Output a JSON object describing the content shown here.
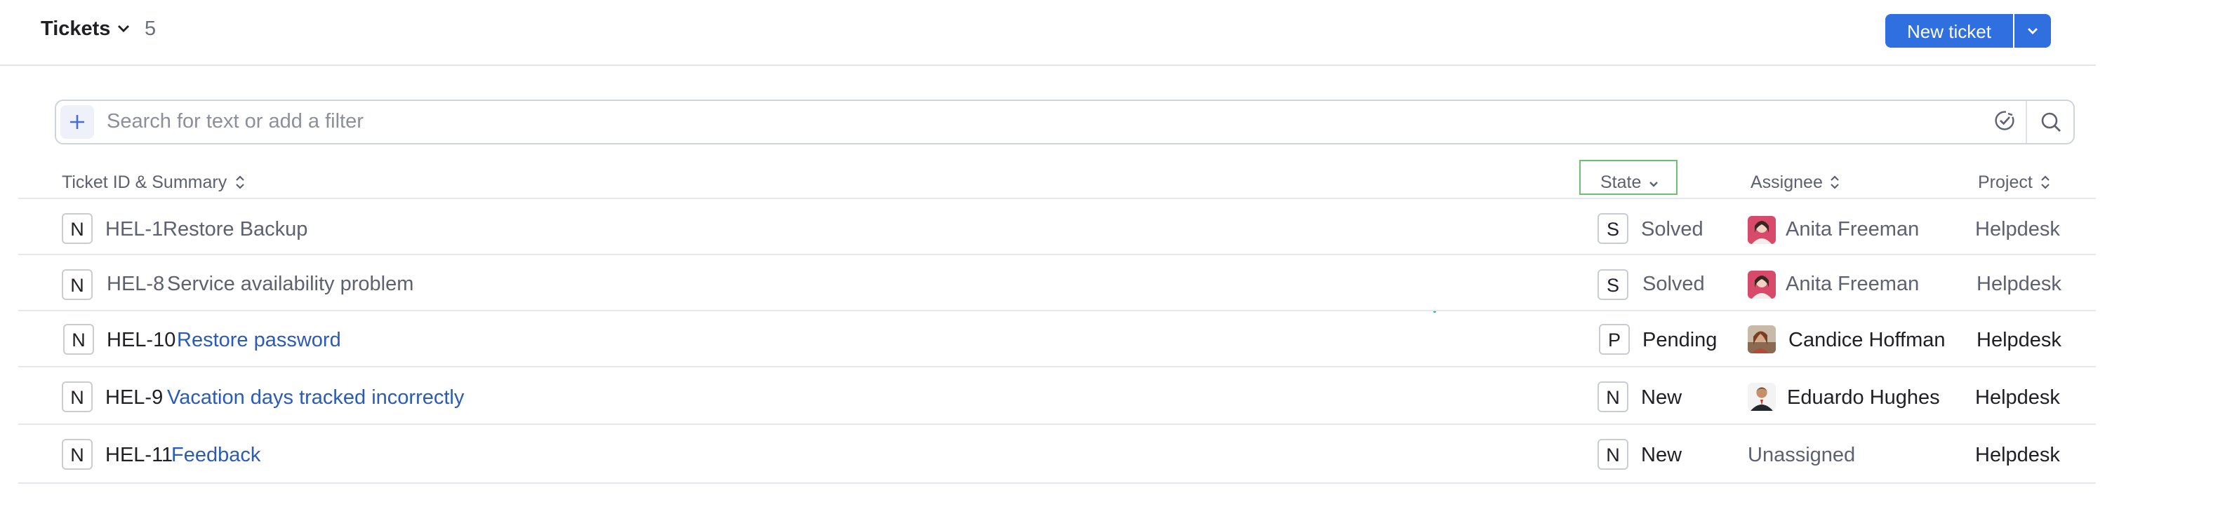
{
  "header": {
    "title": "Tickets",
    "count": "5",
    "new_ticket_label": "New ticket"
  },
  "search": {
    "placeholder": "Search for text or add a filter"
  },
  "columns": {
    "summary": "Ticket ID & Summary",
    "state": "State",
    "assignee": "Assignee",
    "project": "Project"
  },
  "rows": [
    {
      "badge": "N",
      "id": "HEL-1",
      "summary": "Restore Backup",
      "state_badge": "S",
      "state": "Solved",
      "assignee": "Anita Freeman",
      "project": "Helpdesk",
      "read": true
    },
    {
      "badge": "N",
      "id": "HEL-8",
      "summary": "Service availability problem",
      "state_badge": "S",
      "state": "Solved",
      "assignee": "Anita Freeman",
      "project": "Helpdesk",
      "read": true
    },
    {
      "badge": "N",
      "id": "HEL-10",
      "summary": "Restore password",
      "state_badge": "P",
      "state": "Pending",
      "assignee": "Candice Hoffman",
      "project": "Helpdesk",
      "read": false
    },
    {
      "badge": "N",
      "id": "HEL-9",
      "summary": "Vacation days tracked incorrectly",
      "state_badge": "N",
      "state": "New",
      "assignee": "Eduardo Hughes",
      "project": "Helpdesk",
      "read": false
    },
    {
      "badge": "N",
      "id": "HEL-11",
      "summary": "Feedback",
      "state_badge": "N",
      "state": "New",
      "assignee": "Unassigned",
      "project": "Helpdesk",
      "read": false
    }
  ],
  "colors": {
    "accent": "#2f6fe0",
    "link": "#2a5bb8",
    "highlight": "#6cc06f"
  }
}
